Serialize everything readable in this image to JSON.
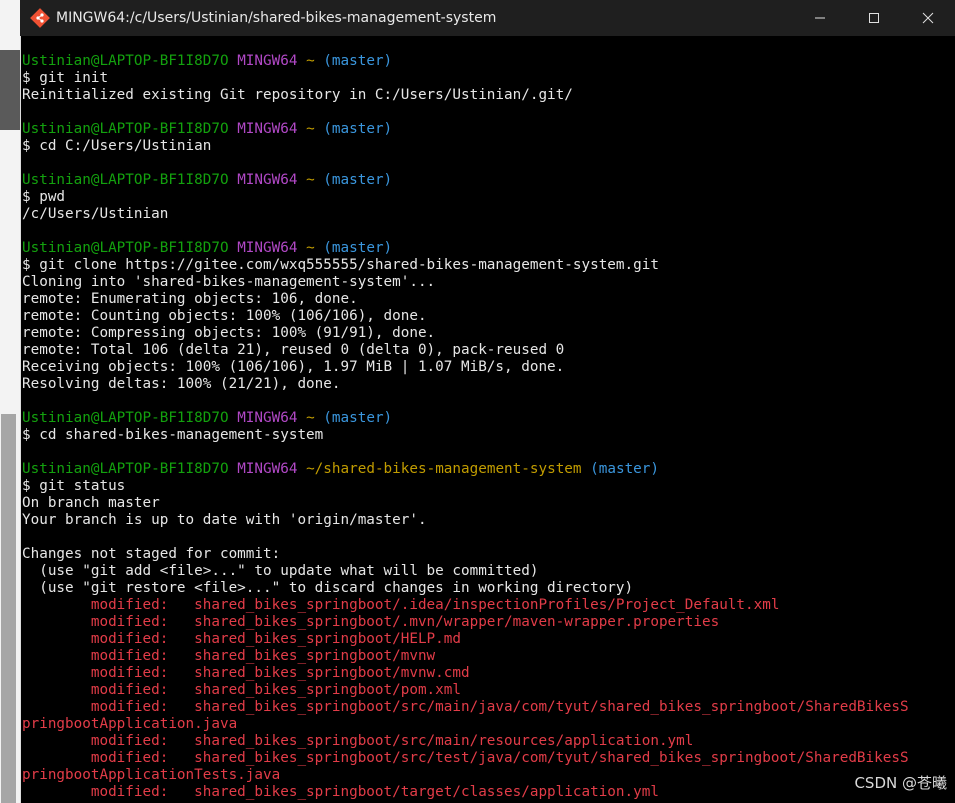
{
  "window": {
    "title": "MINGW64:/c/Users/Ustinian/shared-bikes-management-system"
  },
  "terminal": {
    "prompt_user": "Ustinian@LAPTOP-BF1I8D7O",
    "prompt_host": "MINGW64",
    "prompt_path_home": "~",
    "prompt_path_repo": "~/shared-bikes-management-system",
    "prompt_branch": "(master)",
    "blocks": [
      {
        "path": "~",
        "command": "$ git init",
        "output": [
          "Reinitialized existing Git repository in C:/Users/Ustinian/.git/"
        ]
      },
      {
        "path": "~",
        "command": "$ cd C:/Users/Ustinian",
        "output": []
      },
      {
        "path": "~",
        "command": "$ pwd",
        "output": [
          "/c/Users/Ustinian"
        ]
      },
      {
        "path": "~",
        "command": "$ git clone https://gitee.com/wxq555555/shared-bikes-management-system.git",
        "output": [
          "Cloning into 'shared-bikes-management-system'...",
          "remote: Enumerating objects: 106, done.",
          "remote: Counting objects: 100% (106/106), done.",
          "remote: Compressing objects: 100% (91/91), done.",
          "remote: Total 106 (delta 21), reused 0 (delta 0), pack-reused 0",
          "Receiving objects: 100% (106/106), 1.97 MiB | 1.07 MiB/s, done.",
          "Resolving deltas: 100% (21/21), done."
        ]
      },
      {
        "path": "~",
        "command": "$ cd shared-bikes-management-system",
        "output": []
      },
      {
        "path": "~/shared-bikes-management-system",
        "command": "$ git status",
        "output": [
          "On branch master",
          "Your branch is up to date with 'origin/master'.",
          "",
          "Changes not staged for commit:",
          "  (use \"git add <file>...\" to update what will be committed)",
          "  (use \"git restore <file>...\" to discard changes in working directory)"
        ]
      }
    ],
    "modified_lines": [
      "        modified:   shared_bikes_springboot/.idea/inspectionProfiles/Project_Default.xml",
      "        modified:   shared_bikes_springboot/.mvn/wrapper/maven-wrapper.properties",
      "        modified:   shared_bikes_springboot/HELP.md",
      "        modified:   shared_bikes_springboot/mvnw",
      "        modified:   shared_bikes_springboot/mvnw.cmd",
      "        modified:   shared_bikes_springboot/pom.xml",
      "        modified:   shared_bikes_springboot/src/main/java/com/tyut/shared_bikes_springboot/SharedBikesS",
      "pringbootApplication.java",
      "        modified:   shared_bikes_springboot/src/main/resources/application.yml",
      "        modified:   shared_bikes_springboot/src/test/java/com/tyut/shared_bikes_springboot/SharedBikesS",
      "pringbootApplicationTests.java",
      "        modified:   shared_bikes_springboot/target/classes/application.yml"
    ]
  },
  "watermark": "CSDN @苍曦",
  "colors": {
    "user": "#13a10e",
    "host": "#b148c6",
    "path": "#c19c00",
    "branch": "#3a96dd",
    "modified": "#e23c48"
  }
}
